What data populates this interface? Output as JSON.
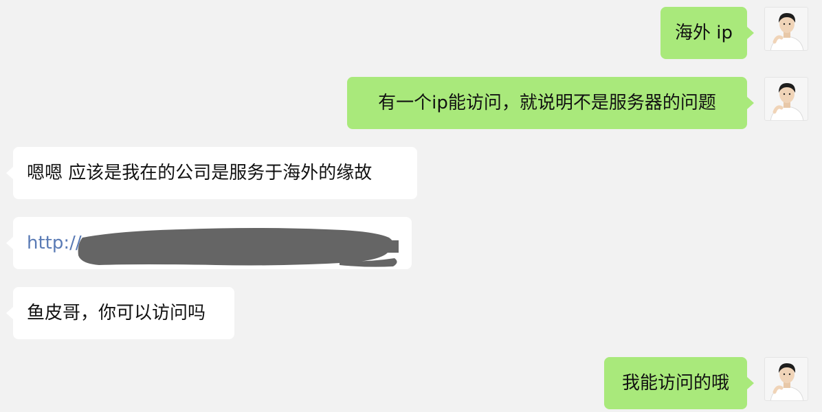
{
  "messages": [
    {
      "side": "out",
      "text": "海外 ip"
    },
    {
      "side": "out",
      "text": "有一个ip能访问，就说明不是服务器的问题"
    },
    {
      "side": "in",
      "text": "嗯嗯 应该是我在的公司是服务于海外的缘故"
    },
    {
      "side": "in",
      "text": "http://",
      "type": "link",
      "redacted": true
    },
    {
      "side": "in",
      "text": "鱼皮哥，你可以访问吗"
    },
    {
      "side": "out",
      "text": "我能访问的哦"
    }
  ],
  "colors": {
    "background": "#f2f2f2",
    "outgoing_bubble": "#a9e97b",
    "incoming_bubble": "#ffffff",
    "link": "#5a7bb5",
    "redaction": "#656565"
  },
  "icons": {
    "avatar": "user-avatar-icon",
    "redaction": "redaction-scribble"
  }
}
